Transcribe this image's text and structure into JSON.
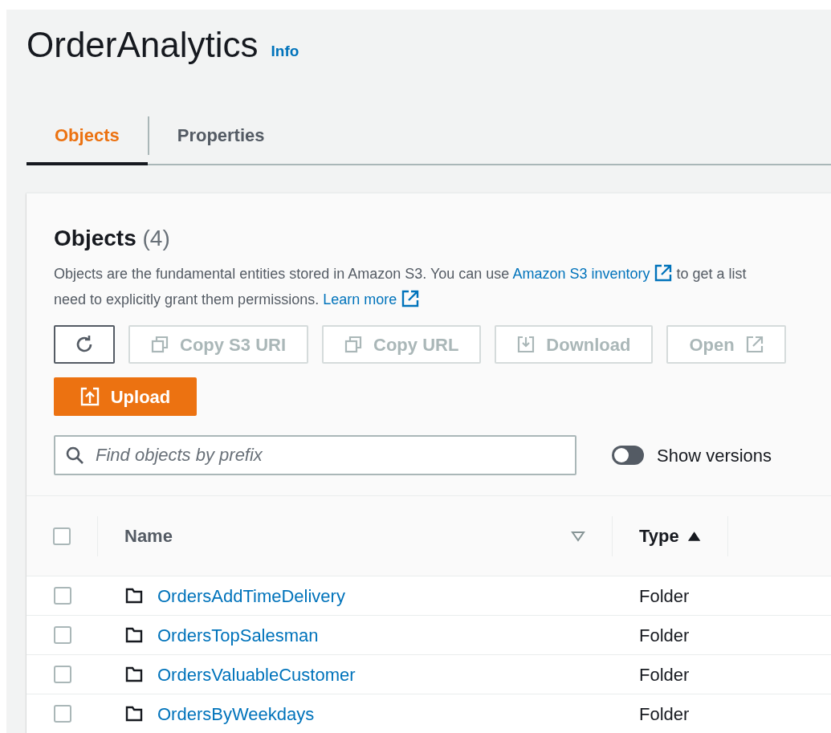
{
  "title": "OrderAnalytics",
  "info_link": "Info",
  "tabs": [
    {
      "label": "Objects",
      "selected": true
    },
    {
      "label": "Properties",
      "selected": false
    }
  ],
  "panel": {
    "heading": "Objects",
    "count": "(4)",
    "description": [
      [
        {
          "kind": "text",
          "text": "Objects are the fundamental entities stored in Amazon S3. You can use "
        },
        {
          "kind": "link",
          "text": "Amazon S3 inventory"
        },
        {
          "kind": "text",
          "text": " to get a list"
        }
      ],
      [
        {
          "kind": "text",
          "text": "need to explicitly grant them permissions. "
        },
        {
          "kind": "link",
          "text": "Learn more"
        }
      ]
    ],
    "buttons": [
      {
        "kind": "refresh",
        "disabled": false
      },
      {
        "kind": "copy",
        "label": "Copy S3 URI",
        "disabled": true
      },
      {
        "kind": "copy",
        "label": "Copy URL",
        "disabled": true
      },
      {
        "kind": "download",
        "label": "Download",
        "disabled": true
      },
      {
        "kind": "open",
        "label": "Open",
        "disabled": true
      }
    ],
    "upload": {
      "label": "Upload"
    },
    "search": {
      "placeholder": "Find objects by prefix"
    },
    "versions_toggle": {
      "label": "Show versions",
      "on": false
    },
    "table": {
      "select_all_checked": false,
      "columns": [
        {
          "label": "Name",
          "kind": "filter"
        },
        {
          "label": "Type",
          "kind": "sort"
        }
      ],
      "rows": [
        {
          "name": "OrdersAddTimeDelivery",
          "type": "Folder",
          "checked": false
        },
        {
          "name": "OrdersTopSalesman",
          "type": "Folder",
          "checked": false
        },
        {
          "name": "OrdersValuableCustomer",
          "type": "Folder",
          "checked": false
        },
        {
          "name": "OrdersByWeekdays",
          "type": "Folder",
          "checked": false
        }
      ]
    }
  }
}
